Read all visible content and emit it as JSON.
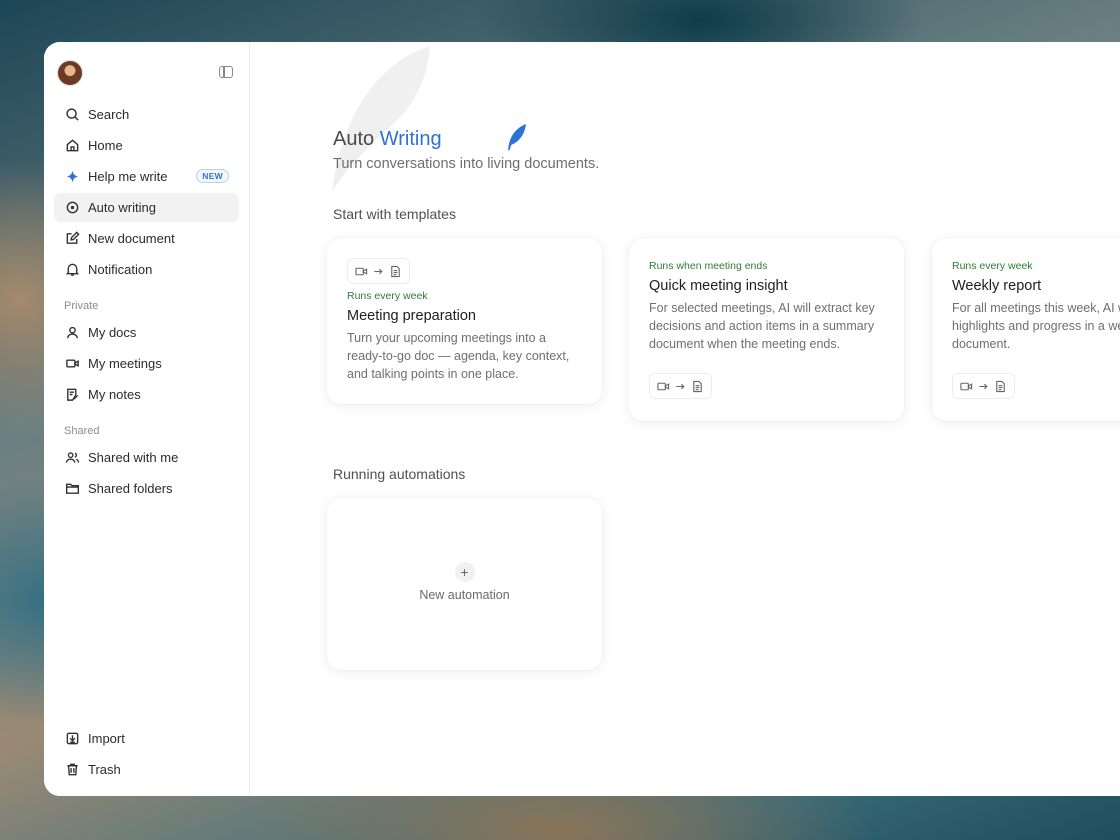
{
  "sidebar": {
    "nav": [
      {
        "label": "Search",
        "icon": "search-icon"
      },
      {
        "label": "Home",
        "icon": "home-icon"
      },
      {
        "label": "Help me write",
        "icon": "sparkle-icon",
        "badge": "NEW"
      },
      {
        "label": "Auto writing",
        "icon": "auto-writing-icon",
        "active": true
      },
      {
        "label": "New document",
        "icon": "edit-icon"
      },
      {
        "label": "Notification",
        "icon": "bell-icon"
      }
    ],
    "private_label": "Private",
    "private": [
      {
        "label": "My docs",
        "icon": "person-icon"
      },
      {
        "label": "My meetings",
        "icon": "video-icon"
      },
      {
        "label": "My notes",
        "icon": "notes-icon"
      }
    ],
    "shared_label": "Shared",
    "shared": [
      {
        "label": "Shared with me",
        "icon": "people-icon"
      },
      {
        "label": "Shared folders",
        "icon": "folder-icon"
      }
    ],
    "bottom": [
      {
        "label": "Import",
        "icon": "import-icon"
      },
      {
        "label": "Trash",
        "icon": "trash-icon"
      }
    ]
  },
  "main": {
    "title_prefix": "Auto",
    "title_accent": "Writing",
    "subtitle": "Turn conversations into living documents.",
    "templates_heading": "Start with templates",
    "templates": [
      {
        "runs": "Runs every week",
        "title": "Meeting preparation",
        "desc": "Turn your upcoming meetings into a ready-to-go doc — agenda, key context, and talking points in one place."
      },
      {
        "runs": "Runs when meeting ends",
        "title": "Quick meeting insight",
        "desc": "For selected meetings, AI will extract key decisions and action items in a summary document when the meeting ends."
      },
      {
        "runs": "Runs every week",
        "title": "Weekly report",
        "desc": "For all meetings this week, AI will compile highlights and progress in a weekly report document."
      }
    ],
    "running_heading": "Running automations",
    "new_automation_label": "New automation"
  },
  "colors": {
    "accent": "#2f72d6",
    "runs_green": "#2e7d3a"
  }
}
